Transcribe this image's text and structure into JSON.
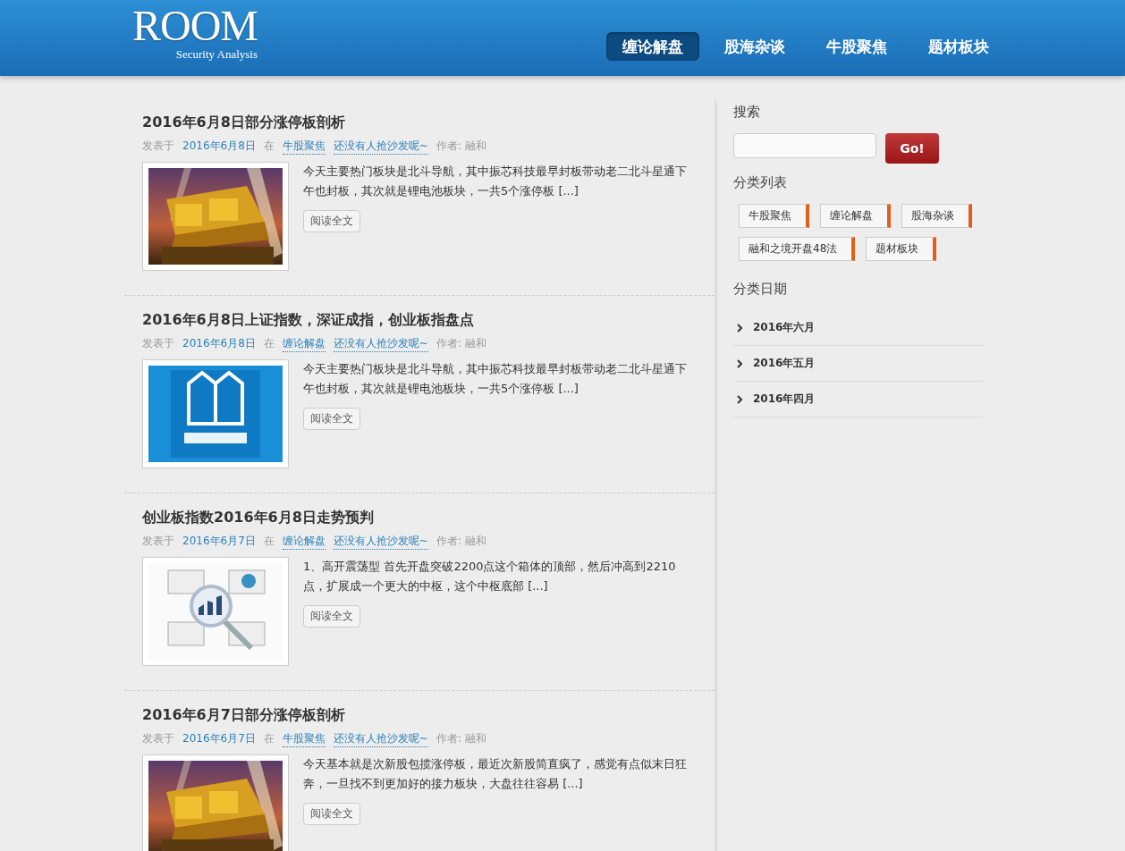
{
  "header": {
    "logo": "ROOM",
    "tagline": "Security Analysis",
    "nav": [
      {
        "label": "缠论解盘",
        "selected": true
      },
      {
        "label": "股海杂谈",
        "selected": false
      },
      {
        "label": "牛股聚焦",
        "selected": false
      },
      {
        "label": "题材板块",
        "selected": false
      }
    ]
  },
  "posts": [
    {
      "title": "2016年6月8日部分涨停板剖析",
      "posted_label": "发表于",
      "date": "2016年6月8日",
      "in_label": "在",
      "category": "牛股聚焦",
      "comments": "还没有人抢沙发呢~",
      "author": "作者: 融和",
      "excerpt": "今天主要热门板块是北斗导航，其中振芯科技最早封板带动老二北斗星通下午也封板，其次就是锂电池板块，一共5个涨停板 [...]",
      "read_more": "阅读全文"
    },
    {
      "title": "2016年6月8日上证指数，深证成指，创业板指盘点",
      "posted_label": "发表于",
      "date": "2016年6月8日",
      "in_label": "在",
      "category": "缠论解盘",
      "comments": "还没有人抢沙发呢~",
      "author": "作者: 融和",
      "excerpt": "今天主要热门板块是北斗导航，其中振芯科技最早封板带动老二北斗星通下午也封板，其次就是锂电池板块，一共5个涨停板 [...]",
      "read_more": "阅读全文"
    },
    {
      "title": "创业板指数2016年6月8日走势预判",
      "posted_label": "发表于",
      "date": "2016年6月7日",
      "in_label": "在",
      "category": "缠论解盘",
      "comments": "还没有人抢沙发呢~",
      "author": "作者: 融和",
      "excerpt": "1、高开震荡型 首先开盘突破2200点这个箱体的顶部，然后冲高到2210点，扩展成一个更大的中枢，这个中枢底部 [...]",
      "read_more": "阅读全文"
    },
    {
      "title": "2016年6月7日部分涨停板剖析",
      "posted_label": "发表于",
      "date": "2016年6月7日",
      "in_label": "在",
      "category": "牛股聚焦",
      "comments": "还没有人抢沙发呢~",
      "author": "作者: 融和",
      "excerpt": "今天基本就是次新股包揽涨停板，最近次新股简直疯了，感觉有点似末日狂奔，一旦找不到更加好的接力板块，大盘往往容易 [...]",
      "read_more": "阅读全文"
    }
  ],
  "sidebar": {
    "search_title": "搜索",
    "search_button": "Go!",
    "categories_title": "分类列表",
    "categories": [
      "牛股聚焦",
      "缠论解盘",
      "股海杂谈",
      "融和之境开盘48法",
      "题材板块"
    ],
    "archives_title": "分类日期",
    "archives": [
      "2016年六月",
      "2016年五月",
      "2016年四月"
    ]
  }
}
